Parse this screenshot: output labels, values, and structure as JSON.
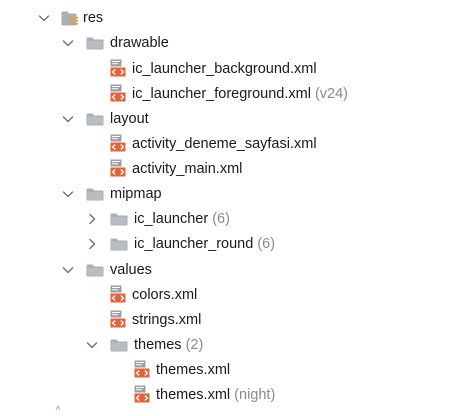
{
  "tree": {
    "res": {
      "label": "res",
      "expanded": true,
      "icon": "resource-folder-icon"
    },
    "drawable": {
      "label": "drawable",
      "expanded": true,
      "icon": "folder-icon",
      "files": [
        {
          "name": "ic_launcher_background.xml",
          "suffix": ""
        },
        {
          "name": "ic_launcher_foreground.xml",
          "suffix": "(v24)"
        }
      ]
    },
    "layout": {
      "label": "layout",
      "expanded": true,
      "icon": "folder-icon",
      "files": [
        {
          "name": "activity_deneme_sayfasi.xml",
          "suffix": ""
        },
        {
          "name": "activity_main.xml",
          "suffix": ""
        }
      ]
    },
    "mipmap": {
      "label": "mipmap",
      "expanded": true,
      "icon": "folder-icon",
      "children": [
        {
          "name": "ic_launcher",
          "count": "(6)",
          "expanded": false
        },
        {
          "name": "ic_launcher_round",
          "count": "(6)",
          "expanded": false
        }
      ]
    },
    "values": {
      "label": "values",
      "expanded": true,
      "icon": "folder-icon",
      "files": [
        {
          "name": "colors.xml",
          "suffix": ""
        },
        {
          "name": "strings.xml",
          "suffix": ""
        }
      ],
      "themes": {
        "label": "themes",
        "count": "(2)",
        "expanded": true,
        "files": [
          {
            "name": "themes.xml",
            "suffix": ""
          },
          {
            "name": "themes.xml",
            "suffix": "(night)"
          }
        ]
      }
    }
  },
  "colors": {
    "folder": "#a8afb6",
    "chevron": "#6e6e6e",
    "xml_orange": "#e0633a",
    "xml_grey": "#9aa0a6",
    "suffix_text": "#8a8a8a"
  }
}
